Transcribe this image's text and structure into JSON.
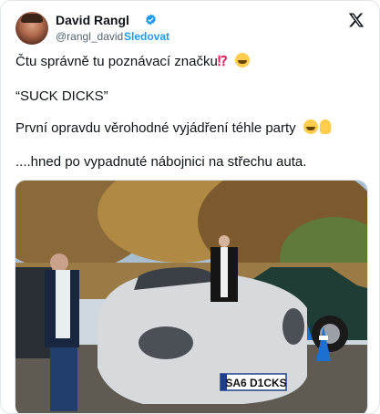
{
  "author": {
    "name": "David Rangl",
    "handle": "@rangl_david",
    "separator": "·",
    "follow_label": "Sledovat"
  },
  "post": {
    "line1": "Čtu správně tu poznávací značku",
    "line1_symbol": "⁉",
    "line2": "“SUCK DICKS”",
    "line3": "První opravdu věrohodné vyjádření téhle party",
    "line4": "....hned po vypadnuté nábojnici na střechu auta."
  },
  "media": {
    "plate_text": "SA6 D1CKS"
  },
  "colors": {
    "accent": "#1d9bf0",
    "text": "#0f1419",
    "muted": "#536471"
  },
  "icons": [
    "verified-badge-icon",
    "x-logo-icon",
    "laughing-emoji-icon",
    "ok-hand-emoji-icon"
  ]
}
